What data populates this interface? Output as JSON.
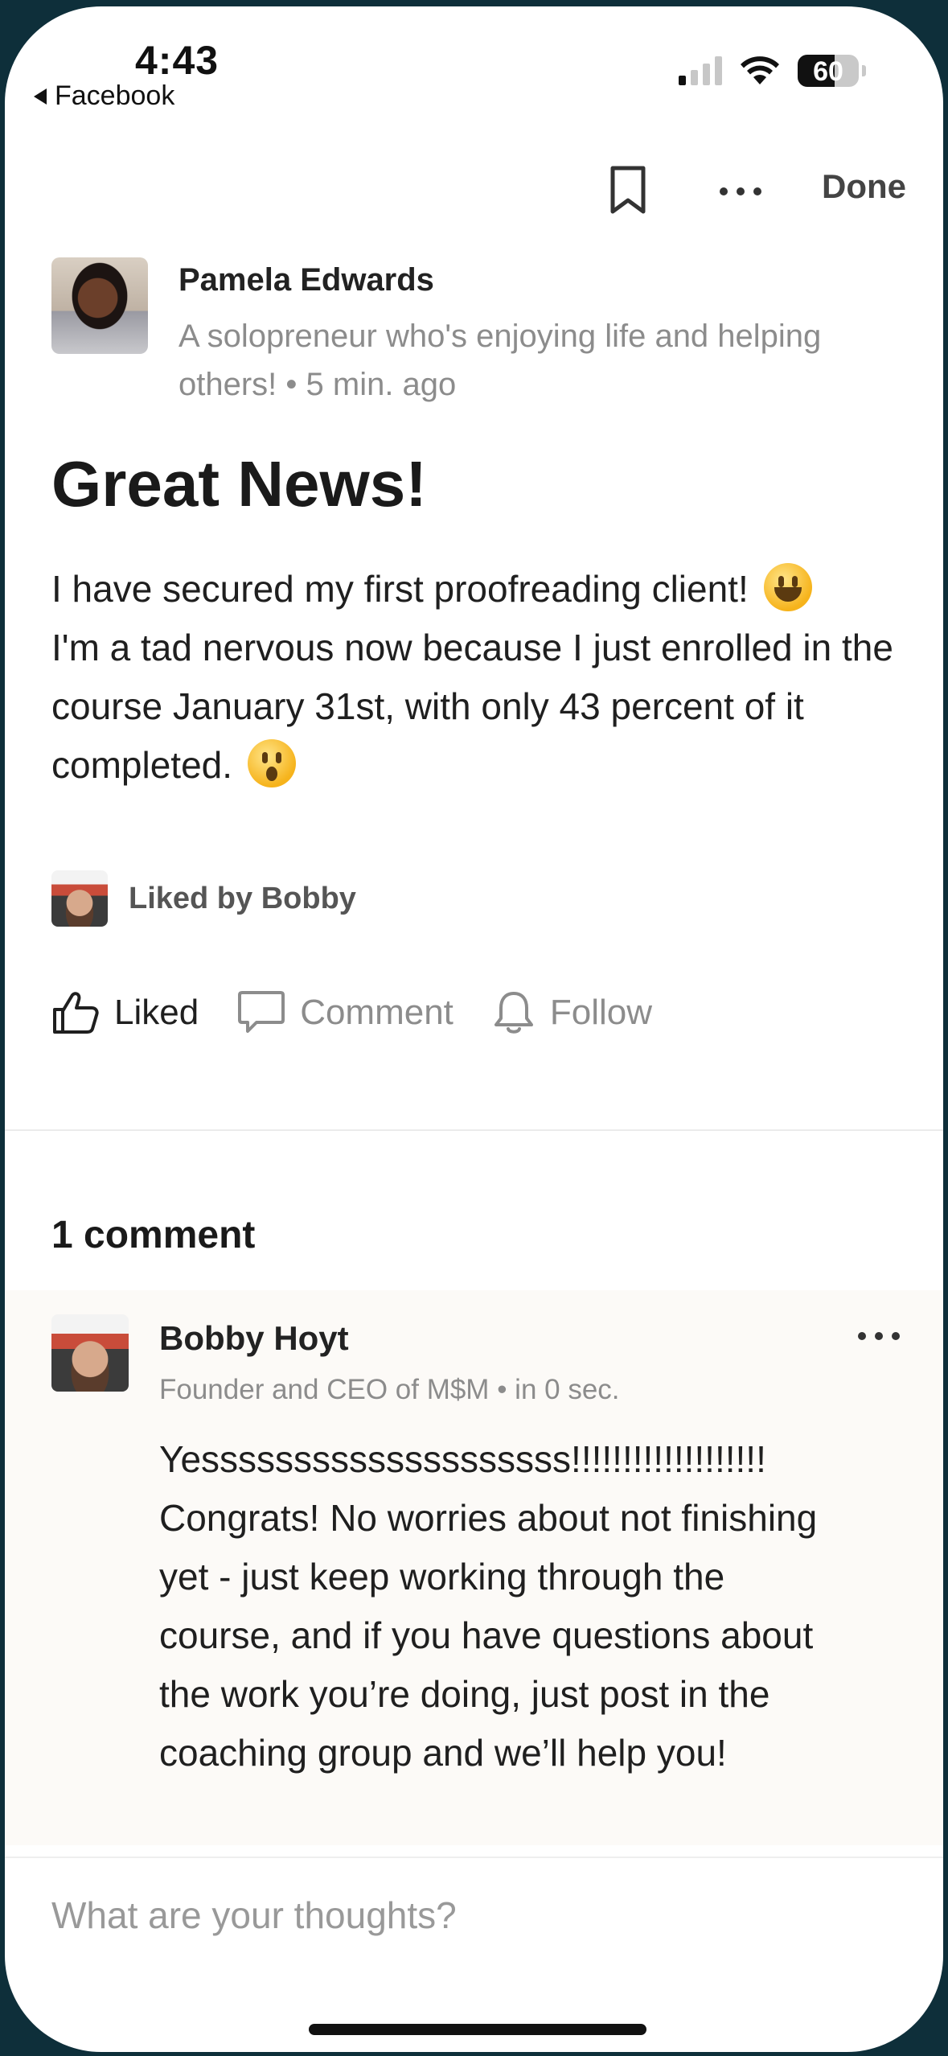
{
  "status_bar": {
    "time": "4:43",
    "back_app": "Facebook",
    "battery": "60",
    "battery_level": 0.6
  },
  "toolbar": {
    "done_label": "Done",
    "bookmark_icon": "bookmark-icon",
    "more_icon": "more-horizontal-icon"
  },
  "post": {
    "author_name": "Pamela Edwards",
    "author_meta": "A solopreneur who's enjoying life and helping others! • 5 min. ago",
    "title": "Great News!",
    "body_line1": "I have secured my first proofreading client!",
    "body_line2": "I'm a tad nervous now because I just enrolled in the course January 31st, with only 43 percent of it completed.",
    "liked_by": "Liked by Bobby",
    "actions": {
      "like": "Liked",
      "comment": "Comment",
      "follow": "Follow"
    }
  },
  "comments": {
    "count_label": "1 comment",
    "items": [
      {
        "name": "Bobby Hoyt",
        "meta": "Founder and CEO of M$M • in 0 sec.",
        "text_a": "Yessssssssssssssssssss!!!!!!!!!!!!!!!!!!!",
        "text_b": " Congrats! No worries about not finishing yet - just keep working through the course, and if you have questions about the work you’re doing, just post in the coaching group and we’ll help you!"
      }
    ]
  },
  "reply": {
    "placeholder": "What are your thoughts?"
  },
  "colors": {
    "muted_text": "#8c8c8c",
    "comment_bg": "#fcfaf7",
    "outer_bg": "#0e2f3a"
  }
}
